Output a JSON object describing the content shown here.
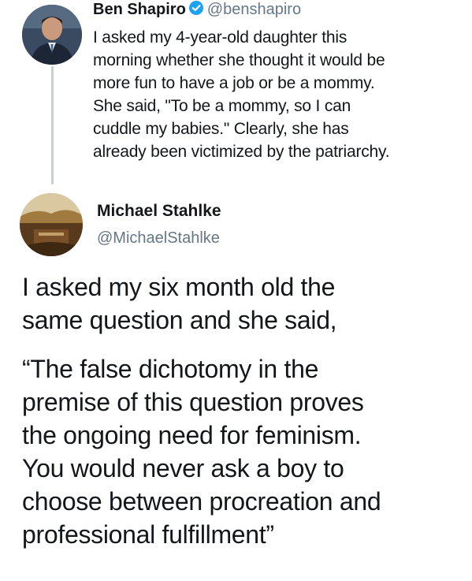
{
  "reply_tweet": {
    "name": "Ben Shapiro",
    "handle": "@benshapiro",
    "verified": true,
    "text_lines": [
      "I asked my 4-year-old daughter this",
      "morning whether she thought it would be",
      "more fun to have a job or be a mommy.",
      "She said, \"To be a mommy, so I can",
      "cuddle my babies.\" Clearly, she has",
      "already been victimized by the patriarchy."
    ]
  },
  "main_tweet": {
    "name": "Michael Stahlke",
    "handle": "@MichaelStahlke",
    "paragraphs": [
      [
        "I asked my six month old the",
        "same question and she said,"
      ],
      [
        "“The false dichotomy in the",
        "premise of this question proves",
        "the ongoing need for feminism.",
        "You would never ask a boy to",
        "choose between procreation and",
        "professional fulfillment”"
      ]
    ]
  },
  "colors": {
    "verified_badge": "#1da1f2",
    "handle_gray": "#657786",
    "text": "#14171a",
    "thread_line": "#c4cfd6"
  }
}
